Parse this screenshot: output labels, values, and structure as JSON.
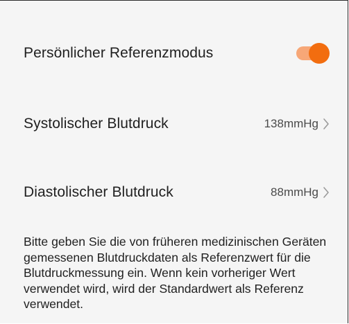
{
  "settings": {
    "reference_mode": {
      "label": "Persönlicher Referenzmodus",
      "enabled": true
    },
    "systolic": {
      "label": "Systolischer Blutdruck",
      "value": "138mmHg"
    },
    "diastolic": {
      "label": "Diastolischer Blutdruck",
      "value": "88mmHg"
    }
  },
  "description": "Bitte geben Sie die von früheren medizinischen Geräten gemessenen Blutdruckdaten als Referenzwert für die Blutdruckmessung ein. Wenn kein vorheriger Wert verwendet wird, wird der Standardwert als Referenz verwendet.",
  "colors": {
    "accent": "#f26d0f",
    "accent_track": "#f7a777",
    "background": "#f5f5f5"
  },
  "icons": {
    "chevron": "chevron-right-icon"
  }
}
